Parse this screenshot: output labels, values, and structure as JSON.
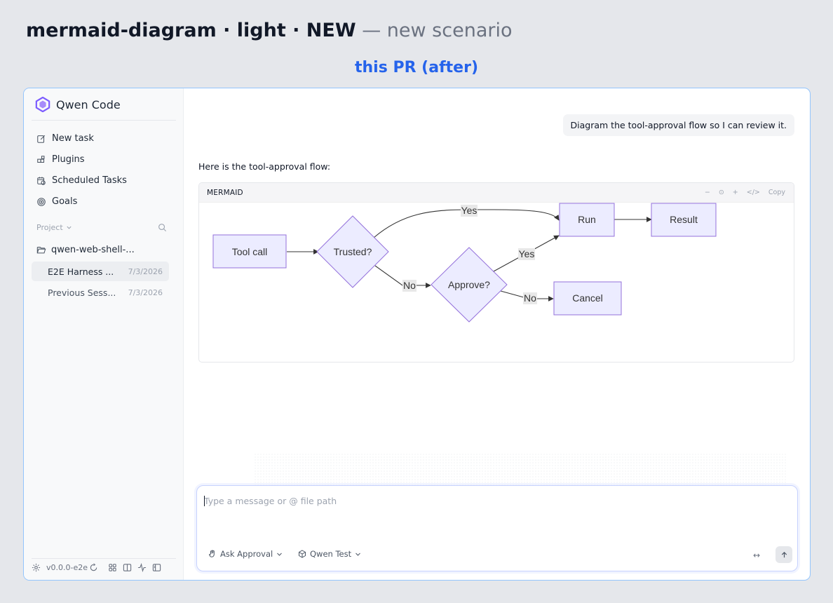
{
  "heading": {
    "title": "mermaid-diagram · light · NEW",
    "separator": "—",
    "subtitle": "new scenario",
    "variant": "this PR (after)"
  },
  "sidebar": {
    "brand": "Qwen Code",
    "nav": [
      {
        "label": "New task",
        "icon": "edit-icon"
      },
      {
        "label": "Plugins",
        "icon": "puzzle-icon"
      },
      {
        "label": "Scheduled Tasks",
        "icon": "calendar-clock-icon"
      },
      {
        "label": "Goals",
        "icon": "target-icon"
      }
    ],
    "project_label": "Project",
    "folder": "qwen-web-shell-...",
    "sessions": [
      {
        "title": "E2E Harness ...",
        "date": "7/3/2026",
        "active": true
      },
      {
        "title": "Previous Sess...",
        "date": "7/3/2026",
        "active": false
      }
    ],
    "version": "v0.0.0-e2e"
  },
  "chat": {
    "user_message": "Diagram the tool-approval flow so I can review it.",
    "assistant_text": "Here is the tool-approval flow:"
  },
  "mermaid": {
    "label": "MERMAID",
    "tools": [
      "−",
      "⊙",
      "+",
      "</>",
      "Copy"
    ],
    "nodes": {
      "tool_call": "Tool call",
      "trusted": "Trusted?",
      "approve": "Approve?",
      "run": "Run",
      "result": "Result",
      "cancel": "Cancel"
    },
    "edges": {
      "trusted_yes": "Yes",
      "trusted_no": "No",
      "approve_yes": "Yes",
      "approve_no": "No"
    },
    "colors": {
      "node_fill": "#ececff",
      "node_stroke": "#9370db",
      "edge_label_bg": "#e8e8e8"
    }
  },
  "composer": {
    "placeholder": "Type a message or @ file path",
    "mode": "Ask Approval",
    "model": "Qwen Test",
    "resize_glyph": "↔"
  }
}
